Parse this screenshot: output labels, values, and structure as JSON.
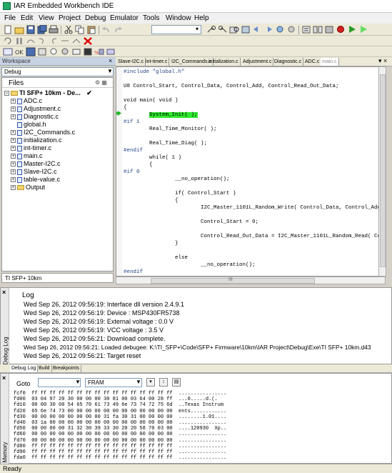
{
  "window": {
    "title": "IAR Embedded Workbench IDE"
  },
  "menu": [
    "File",
    "Edit",
    "View",
    "Project",
    "Debug",
    "Emulator",
    "Tools",
    "Window",
    "Help"
  ],
  "workspace": {
    "header": "Workspace",
    "close": "×",
    "config": "Debug",
    "files_label": "Files",
    "files_icons": "⚙ ▦",
    "tree": [
      {
        "label": "TI SFP+ 10km - De...",
        "level": 0,
        "kind": "project",
        "mark": "✔"
      },
      {
        "label": "ADC.c",
        "level": 1,
        "kind": "file"
      },
      {
        "label": "Adjustment.c",
        "level": 1,
        "kind": "file"
      },
      {
        "label": "Diagnostic.c",
        "level": 1,
        "kind": "file"
      },
      {
        "label": "global.h",
        "level": 1,
        "kind": "header"
      },
      {
        "label": "I2C_Commands.c",
        "level": 1,
        "kind": "file"
      },
      {
        "label": "initialization.c",
        "level": 1,
        "kind": "file"
      },
      {
        "label": "int-timer.c",
        "level": 1,
        "kind": "file"
      },
      {
        "label": "main.c",
        "level": 1,
        "kind": "file"
      },
      {
        "label": "Master-I2C.c",
        "level": 1,
        "kind": "file"
      },
      {
        "label": "Slave-I2C.c",
        "level": 1,
        "kind": "file"
      },
      {
        "label": "table-value.c",
        "level": 1,
        "kind": "file"
      },
      {
        "label": "Output",
        "level": 1,
        "kind": "folder"
      }
    ],
    "tab": "TI SFP+ 10km"
  },
  "editor": {
    "tabs": [
      "Slave-I2C.c",
      "int-timer.c",
      "I2C_Commands.c",
      "initialization.c",
      "Adjustment.c",
      "Diagnostic.c",
      "ADC.c",
      "main.c"
    ],
    "active_tab": 7,
    "close": "▾ ×",
    "lines": [
      "#include \"global.h\"",
      "",
      "U8 Control_Start, Control_Data, Control_Add, Control_Read_Out_Data;",
      "",
      "void main( void )",
      "{",
      "        System_Init( );",
      "#if 1",
      "        Real_Time_Monitor( );",
      "",
      "        Real_Time_Diag( );",
      "#endif",
      "        while( 1 )",
      "        {",
      "#if 0",
      "                __no_operation();",
      "",
      "                if( Control_Start )",
      "                {",
      "                        I2C_Master_1101L_Random_Write( Control_Data, Control_Add",
      "",
      "                        Control_Start = 0;",
      "",
      "                        Control_Read_Out_Data = I2C_Master_1101L_Random_Read( Con",
      "                }",
      "",
      "                else",
      "                        __no_operation();",
      "#endif"
    ],
    "highlight_line": 6,
    "highlight_text": "System_Init( );",
    "scroll_label": "III"
  },
  "log": {
    "side_label": "Debug Log",
    "heading": "Log",
    "lines": [
      "Wed Sep 26, 2012 09:56:19: Interface dll version 2.4.9.1",
      "Wed Sep 26, 2012 09:56:19: Device : MSP430FR5738",
      "Wed Sep 26, 2012 09:56:19: External voltage : 0.0 V",
      "Wed Sep 26, 2012 09:56:19: VCC voltage : 3.5 V",
      "Wed Sep 26, 2012 09:56:21: Download complete.",
      "Wed Sep 26, 2012 09:56:21: Loaded debugee: K:\\TI_SFP+\\Code\\SFP+ Firmware\\10km\\IAR Project\\Debug\\Exe\\TI SFP+ 10km.d43",
      "Wed Sep 26, 2012 09:56:21: Target reset"
    ]
  },
  "debug_tabs": [
    "Debug Log",
    "Build",
    "Breakpoints"
  ],
  "memory": {
    "side_label": "Memory",
    "goto_label": "Goto",
    "goto_value": "",
    "zone": "FRAM",
    "rows": [
      "fcf0  ff ff ff ff ff ff ff ff ff ff ff ff ff ff ff ff  ................",
      "fd00  03 04 97 20 30 00 00 00 30 81 00 03 64 00 28 ff  ...0.....d.(.",
      "fd10  00 00 30 00 54 65 70 61 73 49 6e 73 74 72 75 6d  ..Texas Instrum",
      "fd20  65 6e 74 73 00 00 00 00 00 00 00 00 00 00 00 00  ents............",
      "fd30  00 00 00 00 00 00 00 00 31 fa 30 31 00 00 00 00  ........1.01....",
      "fd40  03 1a 00 00 00 00 00 00 00 00 00 00 00 00 00 00  ................",
      "fd50  00 00 00 00 31 32 30 39 33 30 20 20 58 70 03 00  ....120930  Xp..",
      "fd60  00 00 00 00 00 00 00 00 00 00 00 00 00 00 00 00  ................",
      "fd70  00 00 00 00 00 00 00 00 00 00 00 00 00 00 00 00  ................",
      "fd80  ff ff ff ff ff ff ff ff ff ff ff ff ff ff ff ff  ................",
      "fd90  ff ff ff ff ff ff ff ff ff ff ff ff ff ff ff ff  ................",
      "fda0  ff ff ff ff ff ff ff ff ff ff ff ff ff ff ff ff  ................"
    ]
  },
  "status": "Ready"
}
